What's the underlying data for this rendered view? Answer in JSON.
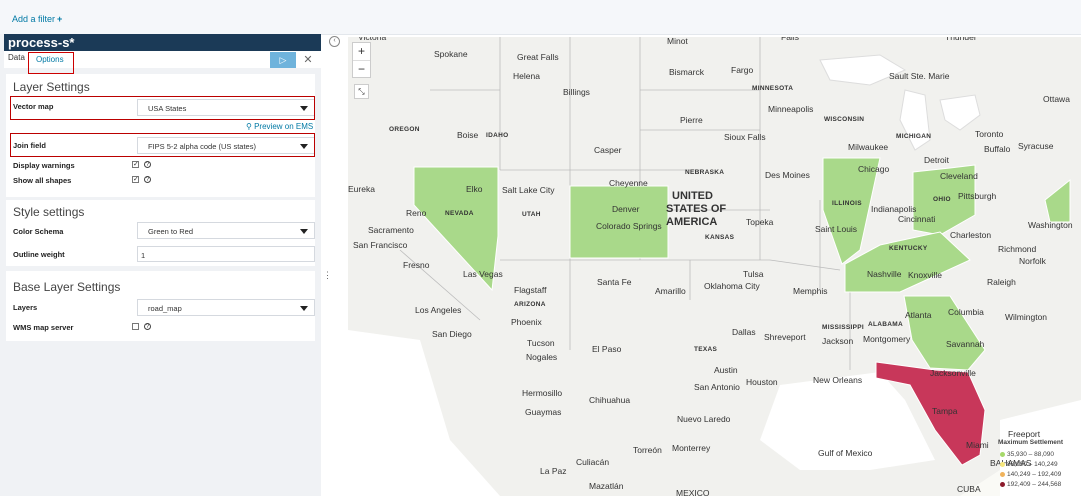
{
  "filter_bar": {
    "add_filter": "Add a filter",
    "plus": "+"
  },
  "panel": {
    "title": "process-s*",
    "tabs": {
      "data": "Data",
      "options": "Options"
    },
    "apply_icon": "▷",
    "close_icon": "✕",
    "layer": {
      "title": "Layer Settings",
      "vector_map_label": "Vector map",
      "vector_map_value": "USA States",
      "preview": "Preview on EMS",
      "join_field_label": "Join field",
      "join_field_value": "FIPS 5-2 alpha code (US states)",
      "display_warnings_label": "Display warnings",
      "show_all_shapes_label": "Show all shapes",
      "display_warnings_checked": true,
      "show_all_shapes_checked": true
    },
    "style": {
      "title": "Style settings",
      "color_schema_label": "Color Schema",
      "color_schema_value": "Green to Red",
      "outline_weight_label": "Outline weight",
      "outline_weight_value": "1"
    },
    "base": {
      "title": "Base Layer Settings",
      "layers_label": "Layers",
      "layers_value": "road_map",
      "wms_label": "WMS map server",
      "wms_checked": false
    }
  },
  "map": {
    "zoom_in": "+",
    "zoom_out": "−",
    "fit_icon": "⤡",
    "collapse_icon": "‹",
    "country_label_1": "UNITED",
    "country_label_2": "STATES OF",
    "country_label_3": "AMERICA",
    "cities": [
      "Victoria",
      "Spokane",
      "Great Falls",
      "Helena",
      "Billings",
      "Minot",
      "Bismarck",
      "Fargo",
      "Falls",
      "Thunder",
      "Sault Ste. Marie",
      "Ottawa",
      "Minneapolis",
      "Pierre",
      "Sioux Falls",
      "Milwaukee",
      "Toronto",
      "Buffalo",
      "Syracuse",
      "Boise",
      "Casper",
      "Chicago",
      "Detroit",
      "Cleveland",
      "Pittsburgh",
      "Salt Lake City",
      "Cheyenne",
      "Des Moines",
      "Elko",
      "Reno",
      "Denver",
      "Colorado Springs",
      "Topeka",
      "Indianapolis",
      "Cincinnati",
      "Charleston",
      "Washington",
      "Richmond",
      "Norfolk",
      "Sacramento",
      "San Francisco",
      "Fresno",
      "Las Vegas",
      "Nashville",
      "Knoxville",
      "Saint Louis",
      "Raleigh",
      "Flagstaff",
      "Santa Fe",
      "Amarillo",
      "Oklahoma City",
      "Tulsa",
      "Memphis",
      "Wilmington",
      "Los Angeles",
      "San Diego",
      "Phoenix",
      "Tucson",
      "Nogales",
      "El Paso",
      "Dallas",
      "Shreveport",
      "Jackson",
      "Montgomery",
      "Atlanta",
      "Columbia",
      "Savannah",
      "Austin",
      "San Antonio",
      "Houston",
      "New Orleans",
      "Jacksonville",
      "Tampa",
      "Miami",
      "Freeport",
      "Hermosillo",
      "Guaymas",
      "Chihuahua",
      "Nuevo Laredo",
      "Torreón",
      "Monterrey",
      "Culiacán",
      "La Paz",
      "Mazatlán",
      "Gulf of Mexico",
      "Eureka",
      "BAHAMAS",
      "CUBA",
      "MEXICO"
    ],
    "states": [
      "OREGON",
      "IDAHO",
      "NEVADA",
      "UTAH",
      "ARIZONA",
      "NEBRASKA",
      "KANSAS",
      "TEXAS",
      "MINNESOTA",
      "WISCONSIN",
      "MICHIGAN",
      "ILLINOIS",
      "OHIO",
      "KENTUCKY",
      "MISSISSIPPI",
      "ALABAMA"
    ],
    "legend": {
      "title": "Maximum Settlement",
      "items": [
        {
          "label": "35,930 – 88,090",
          "color": "#a6d96a"
        },
        {
          "label": "88,090 – 140,249",
          "color": "#f7e77d"
        },
        {
          "label": "140,249 – 192,409",
          "color": "#f0b35c"
        },
        {
          "label": "192,409 – 244,568",
          "color": "#8c1b2c"
        }
      ]
    },
    "colors": {
      "green": "#a9d98a",
      "red": "#c8375a",
      "water": "#fafaf6",
      "border": "#b9b9b9"
    }
  }
}
